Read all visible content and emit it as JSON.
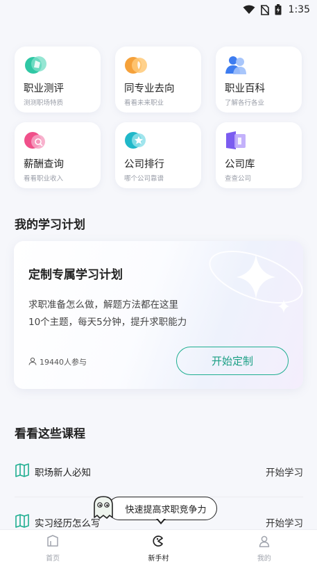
{
  "status_bar": {
    "time": "1:35"
  },
  "tools": [
    {
      "title": "职业测评",
      "subtitle": "测测职场特质",
      "icon": "career-test-icon"
    },
    {
      "title": "同专业去向",
      "subtitle": "看看未来职业",
      "icon": "major-destination-icon"
    },
    {
      "title": "职业百科",
      "subtitle": "了解各行各业",
      "icon": "career-encyclopedia-icon"
    },
    {
      "title": "薪酬查询",
      "subtitle": "看看职业收入",
      "icon": "salary-query-icon"
    },
    {
      "title": "公司排行",
      "subtitle": "哪个公司靠谱",
      "icon": "company-ranking-icon"
    },
    {
      "title": "公司库",
      "subtitle": "查查公司",
      "icon": "company-library-icon"
    }
  ],
  "study_plan": {
    "section_title": "我的学习计划",
    "card_title": "定制专属学习计划",
    "desc_line1": "求职准备怎么做，解题方法都在这里",
    "desc_line2": "10个主题，每天5分钟，提升求职能力",
    "participants": "19440人参与",
    "button_label": "开始定制"
  },
  "courses": {
    "section_title": "看看这些课程",
    "items": [
      {
        "name": "职场新人必知",
        "action": "开始学习"
      },
      {
        "name": "实习经历怎么写",
        "action": "开始学习"
      }
    ]
  },
  "tooltip": {
    "text": "快速提高求职竞争力"
  },
  "bottom_nav": {
    "items": [
      {
        "label": "首页",
        "icon": "home-icon"
      },
      {
        "label": "新手村",
        "icon": "newbie-village-icon"
      },
      {
        "label": "我的",
        "icon": "profile-icon"
      }
    ],
    "active_label": "新手村"
  },
  "colors": {
    "accent_green": "#1eae90",
    "page_bg": "#f6f7fb"
  }
}
